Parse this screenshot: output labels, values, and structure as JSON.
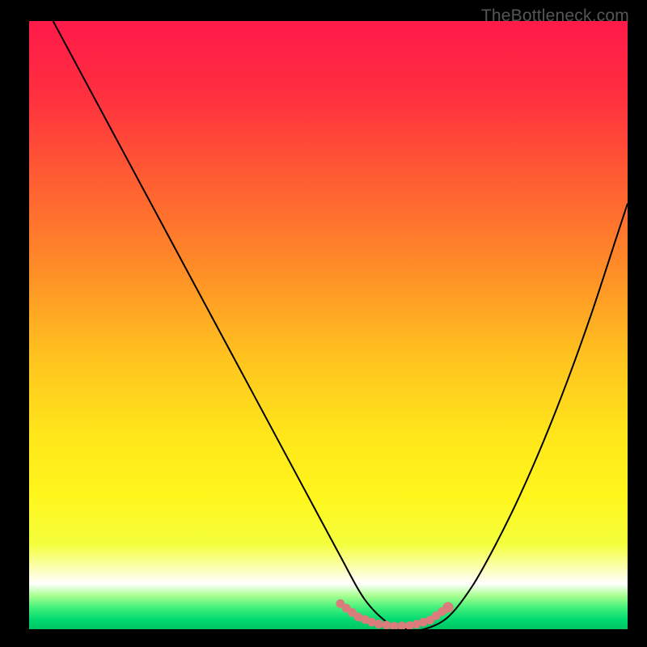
{
  "source_label": "TheBottleneck.com",
  "colors": {
    "bg": "#000000",
    "curve": "#000000",
    "dotted": "#db7c7c",
    "gradient_stops": [
      {
        "offset": 0.0,
        "color": "#ff1a4a"
      },
      {
        "offset": 0.12,
        "color": "#ff2f3f"
      },
      {
        "offset": 0.25,
        "color": "#ff5a33"
      },
      {
        "offset": 0.4,
        "color": "#ff8a28"
      },
      {
        "offset": 0.55,
        "color": "#ffc21f"
      },
      {
        "offset": 0.68,
        "color": "#ffe61a"
      },
      {
        "offset": 0.78,
        "color": "#fff61c"
      },
      {
        "offset": 0.86,
        "color": "#f4ff3c"
      },
      {
        "offset": 0.9,
        "color": "#fcffb4"
      },
      {
        "offset": 0.925,
        "color": "#ffffff"
      },
      {
        "offset": 0.945,
        "color": "#a8ff90"
      },
      {
        "offset": 0.965,
        "color": "#40f07a"
      },
      {
        "offset": 0.985,
        "color": "#00d870"
      },
      {
        "offset": 1.0,
        "color": "#00c562"
      }
    ]
  },
  "chart_data": {
    "type": "line",
    "title": "",
    "xlabel": "",
    "ylabel": "",
    "xlim": [
      0,
      100
    ],
    "ylim": [
      0,
      100
    ],
    "series": [
      {
        "name": "bottleneck-curve",
        "x": [
          4,
          10,
          16,
          22,
          28,
          34,
          40,
          46,
          52,
          56,
          60,
          63,
          66,
          70,
          74,
          78,
          82,
          86,
          90,
          94,
          98,
          100
        ],
        "values": [
          100,
          89,
          78,
          67,
          56,
          45,
          34,
          23,
          12,
          5,
          1,
          0,
          0,
          2,
          7,
          14,
          22,
          31,
          41,
          52,
          64,
          70
        ]
      }
    ],
    "dotted_segment": {
      "name": "optimal-zone",
      "x": [
        52,
        55,
        58,
        61,
        64,
        67,
        70
      ],
      "values": [
        4.2,
        2.0,
        0.9,
        0.5,
        0.6,
        1.5,
        3.6
      ]
    }
  }
}
